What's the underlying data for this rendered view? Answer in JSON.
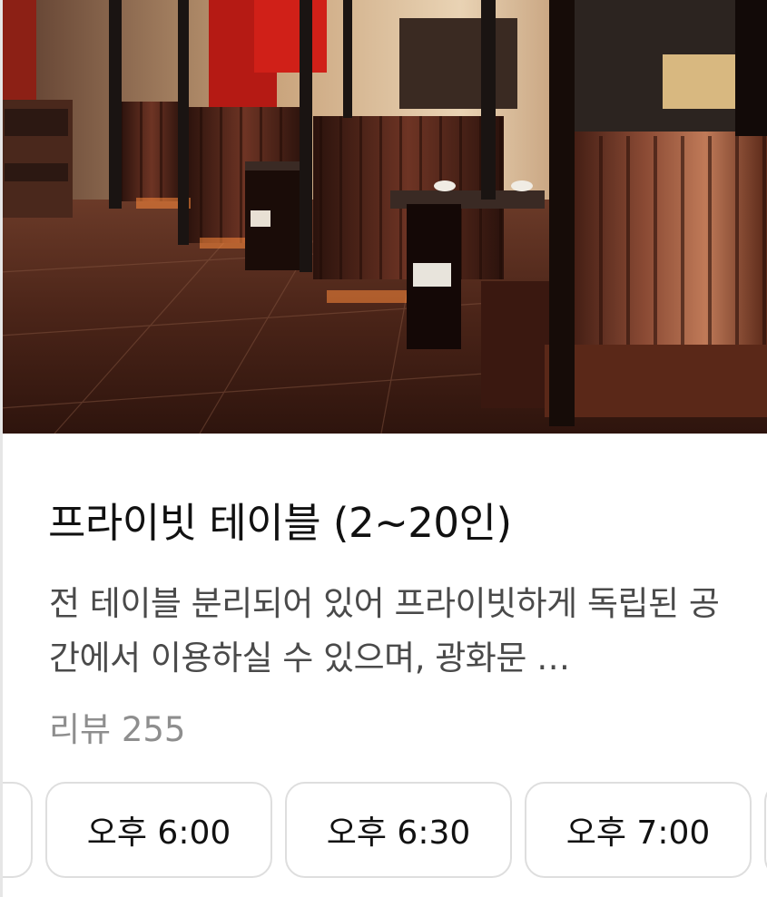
{
  "listing": {
    "title": "프라이빗 테이블 (2~20인)",
    "description": "전 테이블 분리되어 있어 프라이빗하게 독립된 공간에서 이용하실 수 있으며, 광화문 …",
    "review_text": "리뷰 255"
  },
  "time_slots": [
    {
      "label": ""
    },
    {
      "label": "오후 6:00"
    },
    {
      "label": "오후 6:30"
    },
    {
      "label": "오후 7:00"
    },
    {
      "label": ""
    }
  ],
  "colors": {
    "title": "#111111",
    "description": "#4a4a4a",
    "review": "#8e8e8e",
    "slot_border": "#dedede"
  }
}
